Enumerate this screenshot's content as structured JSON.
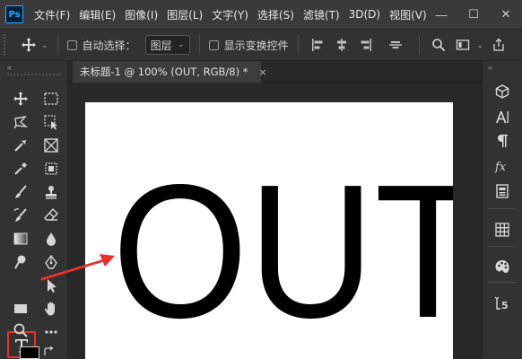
{
  "app": {
    "logo_text": "Ps"
  },
  "menu": [
    "文件(F)",
    "编辑(E)",
    "图像(I)",
    "图层(L)",
    "文字(Y)",
    "选择(S)",
    "滤镜(T)",
    "3D(D)",
    "视图(V)"
  ],
  "window_controls": {
    "minimize": "—",
    "maximize": "☐",
    "close": "✕"
  },
  "options_bar": {
    "auto_select_label": "自动选择：",
    "auto_select_target": "图层",
    "show_transform_label": "显示变换控件"
  },
  "document": {
    "tab_title": "未标题-1 @ 100% (OUT, RGB/8) *",
    "close_glyph": "×",
    "canvas_text": "OUT"
  },
  "colors": {
    "highlight": "#e8322d",
    "arrow": "#e8322d",
    "ps_brand": "#31a8ff"
  },
  "tools": {
    "active": "type-tool"
  }
}
